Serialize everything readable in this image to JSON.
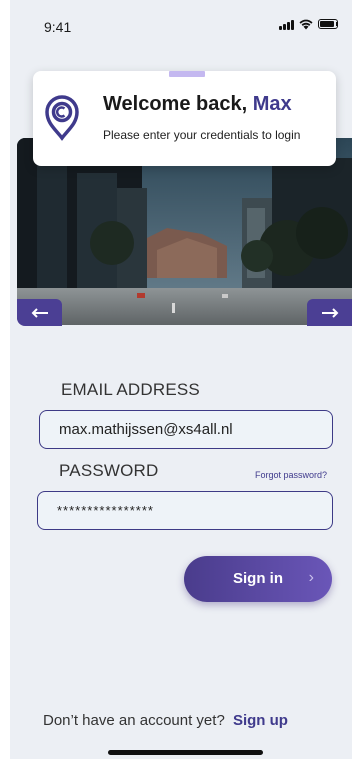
{
  "status_bar": {
    "time": "9:41"
  },
  "welcome": {
    "title_prefix": "Welcome back, ",
    "user_name": "Max",
    "subtitle": "Please enter your credentials to login"
  },
  "form": {
    "email_label": "EMAIL ADDRESS",
    "email_value": "max.mathijssen@xs4all.nl",
    "password_label": "PASSWORD",
    "password_value": "****************",
    "forgot_label": "Forgot password?",
    "signin_label": "Sign in",
    "signin_chevron": "›"
  },
  "footer": {
    "no_account_text": "Don’t have an account yet?",
    "signup_label": "Sign up"
  },
  "colors": {
    "accent": "#3f3a8c",
    "button_gradient_start": "#4a3c8c",
    "button_gradient_end": "#6a56b8",
    "background": "#eceff4"
  },
  "icons": [
    "signal-icon",
    "wifi-icon",
    "battery-icon",
    "location-pin-logo-icon",
    "arrow-left-icon",
    "arrow-right-icon",
    "chevron-right-icon"
  ]
}
